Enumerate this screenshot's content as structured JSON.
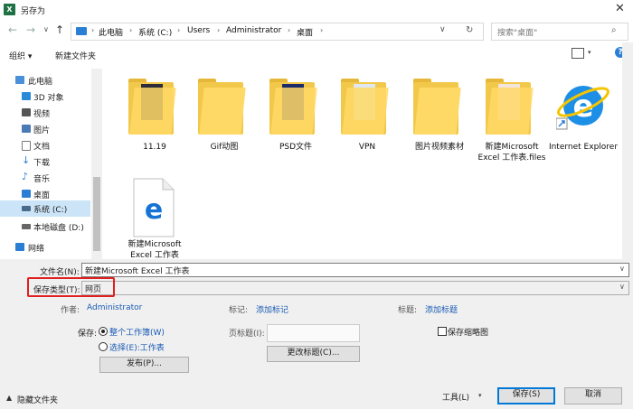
{
  "window": {
    "title": "另存为",
    "app_icon": "excel-icon",
    "close_glyph": "✕"
  },
  "nav": {
    "back_glyph": "←",
    "forward_glyph": "→",
    "dropdown_glyph": "∨",
    "up_glyph": "↑",
    "crumbs": [
      "此电脑",
      "系统 (C:)",
      "Users",
      "Administrator",
      "桌面"
    ],
    "separator": "›",
    "address_dropdown": "∨",
    "refresh_glyph": "↻",
    "search_placeholder": "搜索\"桌面\"",
    "search_glyph": "⌕"
  },
  "toolbar": {
    "organize": "组织 ▾",
    "new_folder": "新建文件夹",
    "view_dropdown": "▾",
    "help_glyph": "?"
  },
  "sidebar": {
    "items": [
      {
        "label": "此电脑",
        "icon": "computer-icon",
        "color": "#4a90d9"
      },
      {
        "label": "3D 对象",
        "icon": "cube-icon",
        "color": "#2a8bd8"
      },
      {
        "label": "视频",
        "icon": "video-icon",
        "color": "#555555"
      },
      {
        "label": "图片",
        "icon": "picture-icon",
        "color": "#4a7bb5"
      },
      {
        "label": "文档",
        "icon": "document-icon",
        "color": "#777777"
      },
      {
        "label": "下载",
        "icon": "download-icon",
        "color": "#2a7fd4"
      },
      {
        "label": "音乐",
        "icon": "music-icon",
        "color": "#2a7fd4"
      },
      {
        "label": "桌面",
        "icon": "desktop-icon",
        "color": "#2a7fd4"
      },
      {
        "label": "系统 (C:)",
        "icon": "drive-icon",
        "color": "#4a6a8a",
        "selected": true
      },
      {
        "label": "本地磁盘 (D:)",
        "icon": "drive-icon",
        "color": "#666666"
      },
      {
        "label": "网络",
        "icon": "network-icon",
        "color": "#2a7fd4"
      }
    ]
  },
  "files": [
    {
      "label": "11.19",
      "type": "folder",
      "icon": "folder-icon"
    },
    {
      "label": "Gif动图",
      "type": "folder",
      "icon": "folder-icon"
    },
    {
      "label": "PSD文件",
      "type": "folder",
      "icon": "folder-icon"
    },
    {
      "label": "VPN",
      "type": "folder",
      "icon": "folder-icon"
    },
    {
      "label": "图片视频素材",
      "type": "folder",
      "icon": "folder-icon"
    },
    {
      "label": "新建Microsoft Excel 工作表.files",
      "type": "folder",
      "icon": "folder-icon"
    },
    {
      "label": "Internet Explorer",
      "type": "shortcut",
      "icon": "internet-explorer-icon"
    },
    {
      "label": "新建Microsoft Excel 工作表",
      "type": "html",
      "icon": "edge-document-icon"
    }
  ],
  "form": {
    "filename_label": "文件名(N):",
    "filename_value": "新建Microsoft Excel 工作表",
    "filetype_label": "保存类型(T):",
    "filetype_value": "网页",
    "dropdown_glyph": "∨",
    "author_label": "作者:",
    "author_value": "Administrator",
    "tags_label": "标记:",
    "tags_value": "添加标记",
    "title_label": "标题:",
    "title_value": "添加标题",
    "save_label": "保存:",
    "radio_workbook": "整个工作簿(W)",
    "radio_selection": "选择(E):工作表",
    "page_title_label": "页标题(I):",
    "thumbnail_label": "保存缩略图",
    "publish_button": "发布(P)...",
    "change_title_button": "更改标题(C)...",
    "hide_folders": "隐藏文件夹",
    "hide_glyph": "▲",
    "tools_button": "工具(L)",
    "save_button": "保存(S)",
    "cancel_button": "取消"
  }
}
